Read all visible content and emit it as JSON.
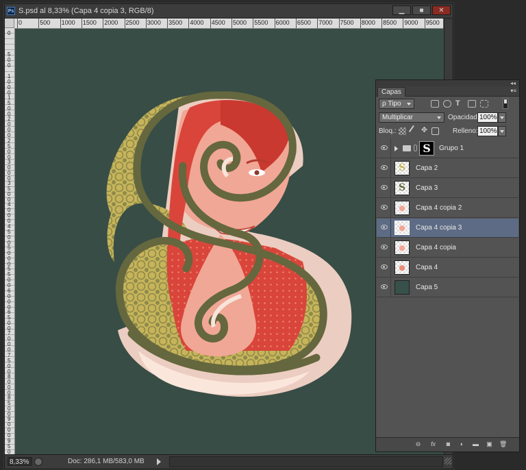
{
  "window": {
    "app_badge": "Ps",
    "title": "S.psd al 8,33% (Capa 4 copia 3, RGB/8)",
    "min_glyph": "▁",
    "max_glyph": "■",
    "close_glyph": "✕"
  },
  "ruler": {
    "h_labels": [
      "0",
      "500",
      "1000",
      "1500",
      "2000",
      "2500",
      "3000",
      "3500",
      "4000",
      "4500",
      "5000",
      "5500",
      "6000",
      "6500",
      "7000",
      "7500",
      "8000",
      "8500",
      "9000",
      "9500"
    ],
    "v_labels": [
      "0",
      "500",
      "1000",
      "1500",
      "2000",
      "2500",
      "3000",
      "3500",
      "4000",
      "4500",
      "5000",
      "5500",
      "6000",
      "6500",
      "7000",
      "7500",
      "8000",
      "8500",
      "9000",
      "9500"
    ]
  },
  "status": {
    "zoom": "8,33%",
    "doc_info": "Doc: 286,1 MB/583,0 MB"
  },
  "panel": {
    "tab_label": "Capas",
    "collapse_glyph": "◂◂",
    "menu_glyph": "▾≡",
    "filter_kind": "ρ Tipo",
    "blend_mode": "Multiplicar",
    "opacity_label": "Opacidad:",
    "opacity_value": "100%",
    "lock_label": "Bloq.:",
    "fill_label": "Relleno:",
    "fill_value": "100%",
    "bottom_link_glyph": "⊖",
    "bottom_fx_glyph": "fx",
    "bottom_mask_glyph": "◙",
    "bottom_adjust_glyph": "◐",
    "bottom_folder_glyph": "▬",
    "bottom_new_glyph": "▣",
    "bottom_trash_glyph": "🗑"
  },
  "layers": [
    {
      "name": "Grupo 1",
      "type": "group",
      "mask_glyph": "S",
      "selected": false
    },
    {
      "name": "Capa 2",
      "type": "layer",
      "thumb_glyph": "S",
      "thumb_color": "#c7b45a",
      "selected": false
    },
    {
      "name": "Capa 3",
      "type": "layer",
      "thumb_glyph": "S",
      "thumb_color": "#5f6b3e",
      "selected": false
    },
    {
      "name": "Capa 4 copia 2",
      "type": "layer",
      "thumb_glyph": "●",
      "thumb_color": "#f1a795",
      "selected": false
    },
    {
      "name": "Capa 4 copia 3",
      "type": "layer",
      "thumb_glyph": "●",
      "thumb_color": "#f1a795",
      "selected": true
    },
    {
      "name": "Capa 4 copia",
      "type": "layer",
      "thumb_glyph": "●",
      "thumb_color": "#f1a795",
      "selected": false
    },
    {
      "name": "Capa 4",
      "type": "layer",
      "thumb_glyph": "●",
      "thumb_color": "#e98d78",
      "selected": false
    },
    {
      "name": "Capa 5",
      "type": "layer",
      "thumb_glyph": "",
      "thumb_color": "#37504a",
      "selected": false
    }
  ],
  "colors": {
    "canvas_bg": "#384d46",
    "letter_outline": "#65673e",
    "letter_pattern": "#c7b45a",
    "skin": "#f1a795",
    "hair": "#d9453a",
    "selection": "#5d6b85"
  }
}
